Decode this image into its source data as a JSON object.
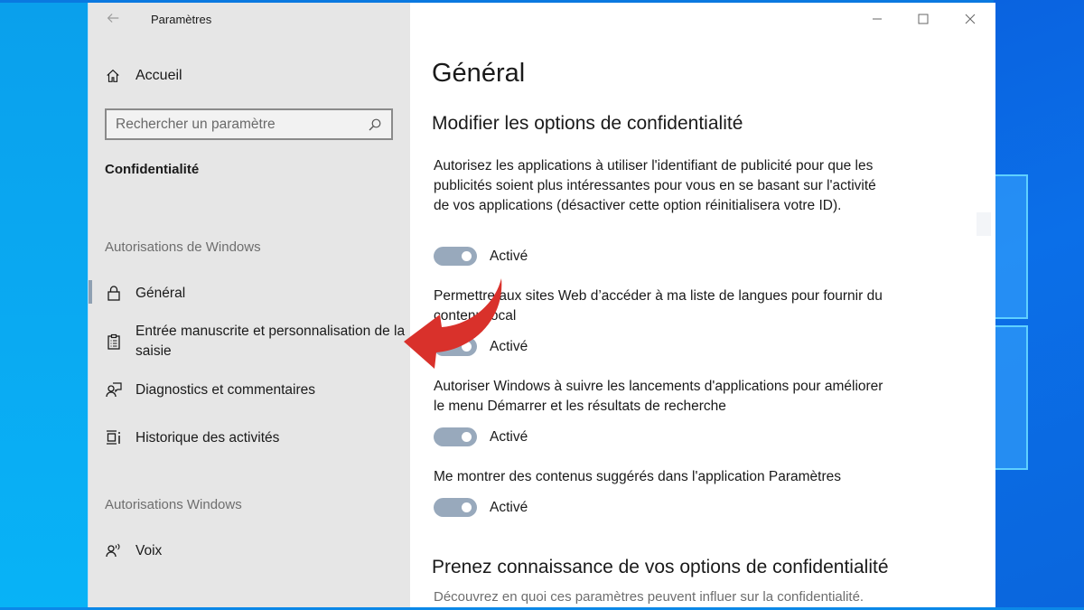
{
  "window": {
    "title": "Paramètres",
    "controls": [
      "minimize",
      "maximize",
      "close"
    ]
  },
  "sidebar": {
    "home_label": "Accueil",
    "search": {
      "placeholder": "Rechercher un paramètre",
      "value": ""
    },
    "section_title": "Confidentialité",
    "groups": [
      {
        "label": "Autorisations de Windows",
        "items": [
          {
            "label": "Général",
            "icon": "lock-icon",
            "active": true
          },
          {
            "label": "Entrée manuscrite et personnalisation de la saisie",
            "icon": "clipboard-list-icon",
            "active": false
          },
          {
            "label": "Diagnostics et commentaires",
            "icon": "feedback-person-icon",
            "active": false
          },
          {
            "label": "Historique des activités",
            "icon": "timeline-icon",
            "active": false
          }
        ]
      },
      {
        "label": "Autorisations Windows",
        "items": [
          {
            "label": "Voix",
            "icon": "speech-person-icon",
            "active": false
          }
        ]
      }
    ]
  },
  "main": {
    "title": "Général",
    "section1_title": "Modifier les options de confidentialité",
    "options": [
      {
        "description": "Autorisez les applications à utiliser l'identifiant de publicité pour que les publicités soient plus intéressantes pour vous en se basant sur l'activité de vos applications (désactiver cette option réinitialisera votre ID).",
        "state_label": "Activé",
        "on": true
      },
      {
        "description": "Permettre aux sites Web d’accéder à ma liste de langues pour fournir du contenu local",
        "state_label": "Activé",
        "on": true
      },
      {
        "description": "Autoriser Windows à suivre les lancements d'applications pour améliorer le menu Démarrer et les résultats de recherche",
        "state_label": "Activé",
        "on": true
      },
      {
        "description": "Me montrer des contenus suggérés dans l'application Paramètres",
        "state_label": "Activé",
        "on": true
      }
    ],
    "section2_title": "Prenez connaissance de vos options de confidentialité",
    "section2_desc": "Découvrez en quoi ces paramètres peuvent influer sur la confidentialité."
  },
  "annotation": {
    "type": "curved-arrow",
    "color": "#d9312b",
    "points_to": "Entrée manuscrite et personnalisation de la saisie"
  },
  "colors": {
    "toggle_on": "#98a9bc",
    "sidebar_bg": "#e6e6e6",
    "desktop_blue": "#0aa0ec"
  }
}
